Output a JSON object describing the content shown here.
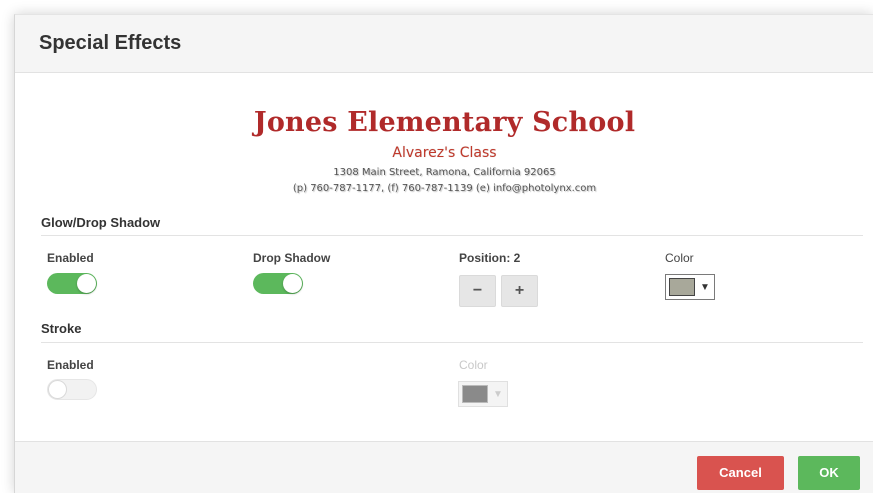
{
  "dialog": {
    "title": "Special Effects"
  },
  "preview": {
    "school_name": "Jones Elementary School",
    "class_name": "Alvarez's Class",
    "address": "1308 Main Street, Ramona, California 92065",
    "contact": "(p) 760-787-1177, (f) 760-787-1139 (e) info@photolynx.com",
    "colors": {
      "title": "#b02a2a",
      "subtitle": "#c0392b"
    }
  },
  "glow": {
    "section_title": "Glow/Drop Shadow",
    "enabled_label": "Enabled",
    "enabled": true,
    "drop_shadow_label": "Drop Shadow",
    "drop_shadow": true,
    "position_label": "Position: 2",
    "minus_label": "−",
    "plus_label": "+",
    "color_label": "Color",
    "color_value": "#a8a89a",
    "caret": "▼"
  },
  "stroke": {
    "section_title": "Stroke",
    "enabled_label": "Enabled",
    "enabled": false,
    "color_label": "Color",
    "color_value": "#8a8a8a",
    "caret": "▼"
  },
  "footer": {
    "cancel_label": "Cancel",
    "ok_label": "OK",
    "colors": {
      "cancel": "#d9534f",
      "ok": "#5cb85c"
    }
  }
}
